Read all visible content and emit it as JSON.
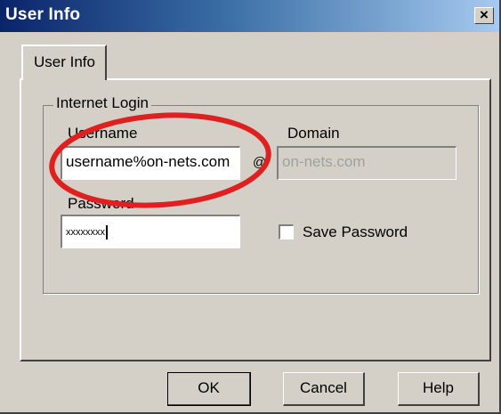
{
  "window": {
    "title": "User Info",
    "close_glyph": "×"
  },
  "tabs": [
    {
      "label": "User Info"
    }
  ],
  "group": {
    "legend": "Internet Login"
  },
  "fields": {
    "username": {
      "label": "Username",
      "value": "username%on-nets.com"
    },
    "domain": {
      "label": "Domain",
      "value": "on-nets.com"
    },
    "password": {
      "label": "Password",
      "value": "xxxxxxxx"
    },
    "at_separator": "@"
  },
  "save_password": {
    "label": "Save Password",
    "checked": false
  },
  "buttons": {
    "ok": "OK",
    "cancel": "Cancel",
    "help": "Help"
  },
  "annotation": {
    "shape": "ellipse",
    "color": "#e02020"
  },
  "colors": {
    "window_bg": "#d4d0c8",
    "title_start": "#0a246a",
    "title_end": "#a6caf0",
    "disabled_text": "#a0a0a0"
  }
}
